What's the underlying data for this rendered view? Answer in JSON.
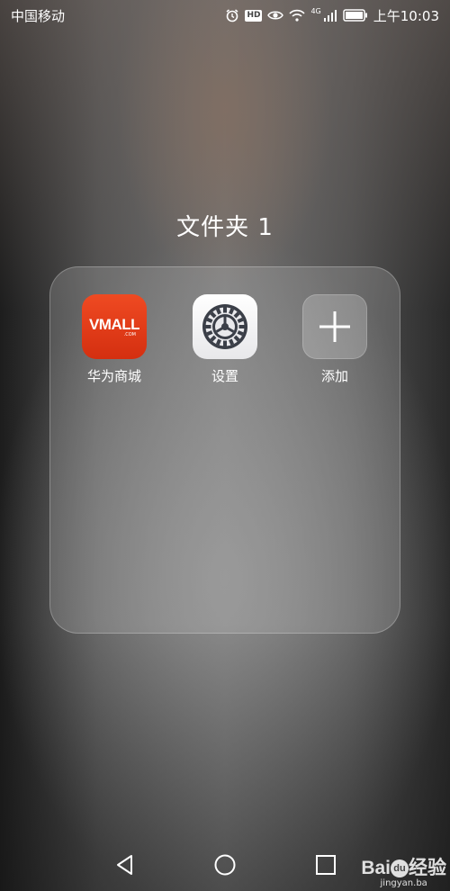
{
  "status_bar": {
    "carrier": "中国移动",
    "hd_badge": "HD",
    "network_type": "4G",
    "time": "上午10:03",
    "icons": [
      "alarm-icon",
      "hd-icon",
      "eye-comfort-icon",
      "wifi-icon",
      "signal-icon",
      "battery-icon"
    ]
  },
  "folder": {
    "title": "文件夹 1",
    "apps": [
      {
        "label": "华为商城",
        "icon": "vmall-icon",
        "icon_text": "VMALL",
        "icon_subtext": ".COM",
        "color": "#e33b18"
      },
      {
        "label": "设置",
        "icon": "settings-gear-icon"
      },
      {
        "label": "添加",
        "icon": "add-plus-icon"
      }
    ]
  },
  "nav_bar": {
    "buttons": [
      "back-icon",
      "home-icon",
      "recents-icon"
    ]
  },
  "watermark": {
    "brand": "Bai",
    "brand_du": "du",
    "brand_suffix": "经验",
    "url": "jingyan.ba"
  }
}
